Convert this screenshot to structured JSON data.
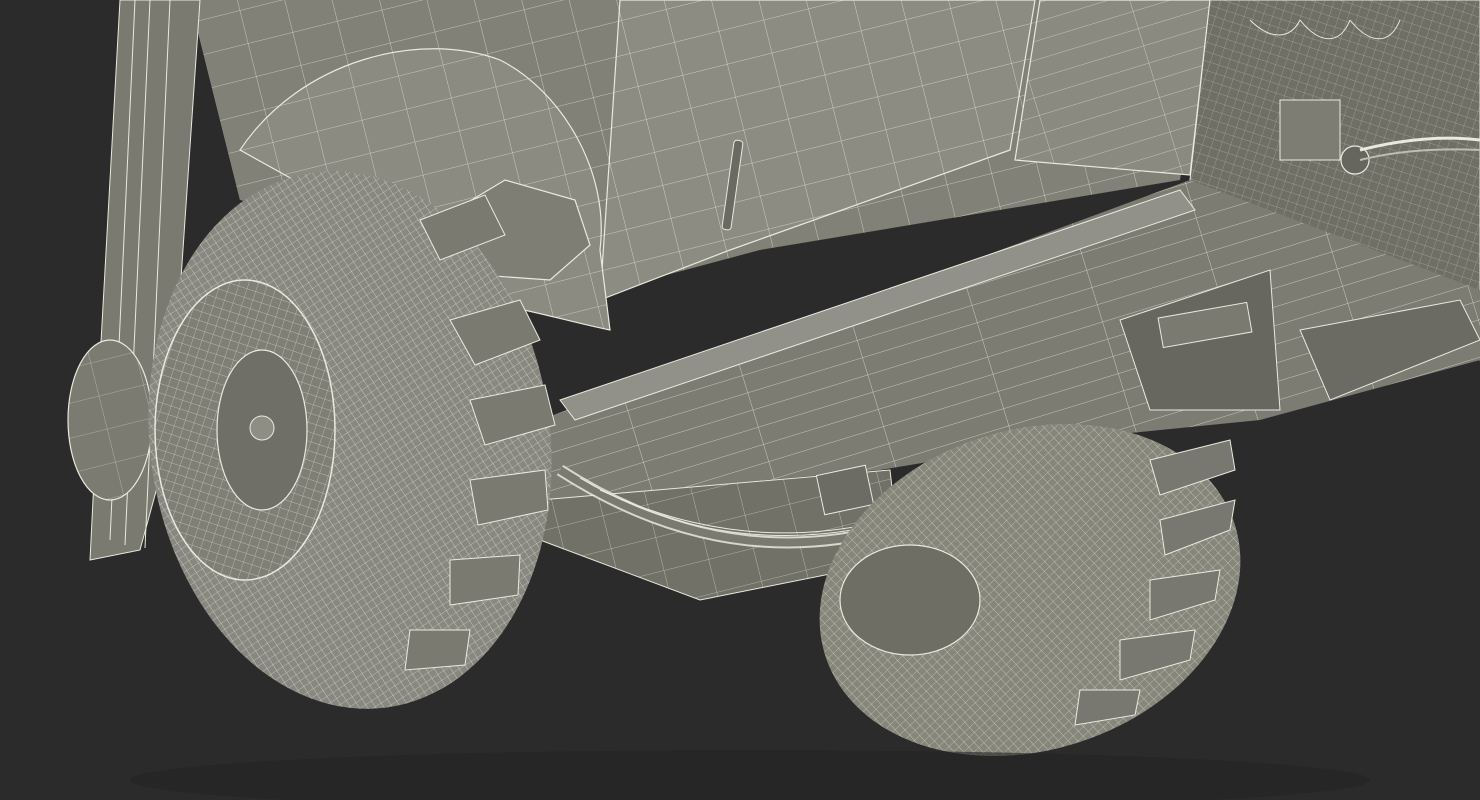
{
  "scene": {
    "subject": "",
    "render_style": "wireframe-on-shaded",
    "colors": {
      "background": "#2b2b2b",
      "body_light": "#8a8a80",
      "body_mid": "#76766c",
      "body_dark": "#5e5e56",
      "tire": "#858579",
      "tire_dark": "#6d6d63",
      "wire": "#e9e9de",
      "shadow": "#3a3a36"
    },
    "icons": [
      "tire-wireframe",
      "leaf-spring",
      "fender",
      "chassis-frame"
    ]
  }
}
